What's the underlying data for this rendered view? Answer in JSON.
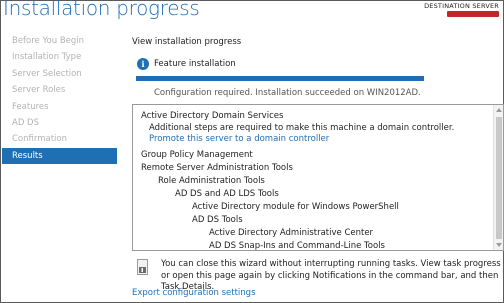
{
  "window": {
    "title": "Installation progress",
    "destination_label": "DESTINATION SERVER"
  },
  "sidebar": {
    "items": [
      {
        "label": "Before You Begin",
        "active": false
      },
      {
        "label": "Installation Type",
        "active": false
      },
      {
        "label": "Server Selection",
        "active": false
      },
      {
        "label": "Server Roles",
        "active": false
      },
      {
        "label": "Features",
        "active": false
      },
      {
        "label": "AD DS",
        "active": false
      },
      {
        "label": "Confirmation",
        "active": false
      },
      {
        "label": "Results",
        "active": true
      }
    ]
  },
  "main": {
    "subheading": "View installation progress",
    "feature_label": "Feature installation",
    "progress_percent": 100,
    "status_text": "Configuration required. Installation succeeded on WIN2012AD.",
    "results": [
      {
        "text": "Active Directory Domain Services",
        "indent": 0,
        "link": false
      },
      {
        "text": "Additional steps are required to make this machine a domain controller.",
        "indent": 1,
        "link": false
      },
      {
        "text": "Promote this server to a domain controller",
        "indent": 1,
        "link": true
      },
      {
        "text": "Group Policy Management",
        "indent": 0,
        "link": false
      },
      {
        "text": "Remote Server Administration Tools",
        "indent": 0,
        "link": false
      },
      {
        "text": "Role Administration Tools",
        "indent": 1,
        "link": false
      },
      {
        "text": "AD DS and AD LDS Tools",
        "indent": 2,
        "link": false
      },
      {
        "text": "Active Directory module for Windows PowerShell",
        "indent": 3,
        "link": false
      },
      {
        "text": "AD DS Tools",
        "indent": 3,
        "link": false
      },
      {
        "text": "Active Directory Administrative Center",
        "indent": 4,
        "link": false
      },
      {
        "text": "AD DS Snap-Ins and Command-Line Tools",
        "indent": 4,
        "link": false
      }
    ],
    "note_text": "You can close this wizard without interrupting running tasks. View task progress or open this page again by clicking Notifications in the command bar, and then Task Details.",
    "export_link": "Export configuration settings"
  },
  "colors": {
    "accent": "#1f6fb4",
    "title": "#1e6db5",
    "inactive_nav": "#b3b3b3",
    "server_highlight": "#c0262c"
  }
}
